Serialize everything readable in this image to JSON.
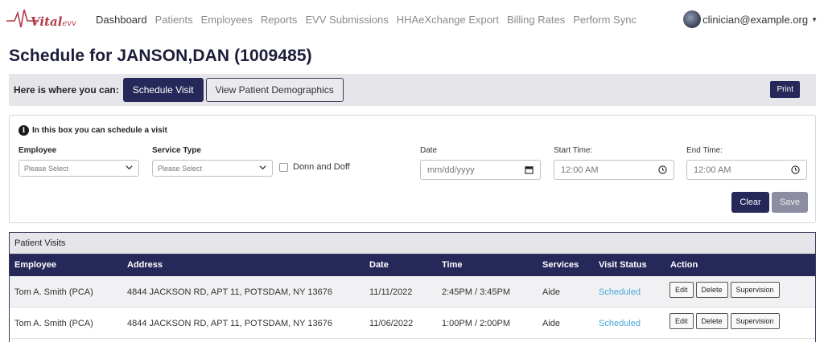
{
  "brand": {
    "name": "Vital",
    "suffix": "evv"
  },
  "nav": {
    "items": [
      {
        "label": "Dashboard",
        "active": true
      },
      {
        "label": "Patients"
      },
      {
        "label": "Employees"
      },
      {
        "label": "Reports"
      },
      {
        "label": "EVV Submissions"
      },
      {
        "label": "HHAeXchange Export"
      },
      {
        "label": "Billing Rates"
      },
      {
        "label": "Perform Sync"
      }
    ],
    "user_email": "clinician@example.org"
  },
  "page": {
    "title": "Schedule for JANSON,DAN (1009485)"
  },
  "toolbar": {
    "label": "Here is where you can:",
    "schedule_visit": "Schedule Visit",
    "view_demographics": "View Patient Demographics",
    "print": "Print"
  },
  "schedule_form": {
    "info": "In this box you can schedule a visit",
    "employee_label": "Employee",
    "employee_placeholder": "Please Select",
    "service_label": "Service Type",
    "service_placeholder": "Please Select",
    "donn_doff_label": "Donn and Doff",
    "date_label": "Date",
    "date_placeholder": "mm/dd/yyyy",
    "start_label": "Start Time:",
    "start_value": "12:00 AM",
    "end_label": "End Time:",
    "end_value": "12:00 AM",
    "clear": "Clear",
    "save": "Save"
  },
  "visits": {
    "title": "Patient Visits",
    "columns": [
      "Employee",
      "Address",
      "Date",
      "Time",
      "Services",
      "Visit Status",
      "Action"
    ],
    "rows": [
      {
        "employee": "Tom A. Smith (PCA)",
        "address": "4844 JACKSON RD, APT 11, POTSDAM, NY 13676",
        "date": "11/11/2022",
        "time": "2:45PM / 3:45PM",
        "services": "Aide",
        "status": "Scheduled"
      },
      {
        "employee": "Tom A. Smith (PCA)",
        "address": "4844 JACKSON RD, APT 11, POTSDAM, NY 13676",
        "date": "11/06/2022",
        "time": "1:00PM / 2:00PM",
        "services": "Aide",
        "status": "Scheduled"
      }
    ],
    "actions": {
      "edit": "Edit",
      "delete": "Delete",
      "supervision": "Supervision"
    }
  }
}
